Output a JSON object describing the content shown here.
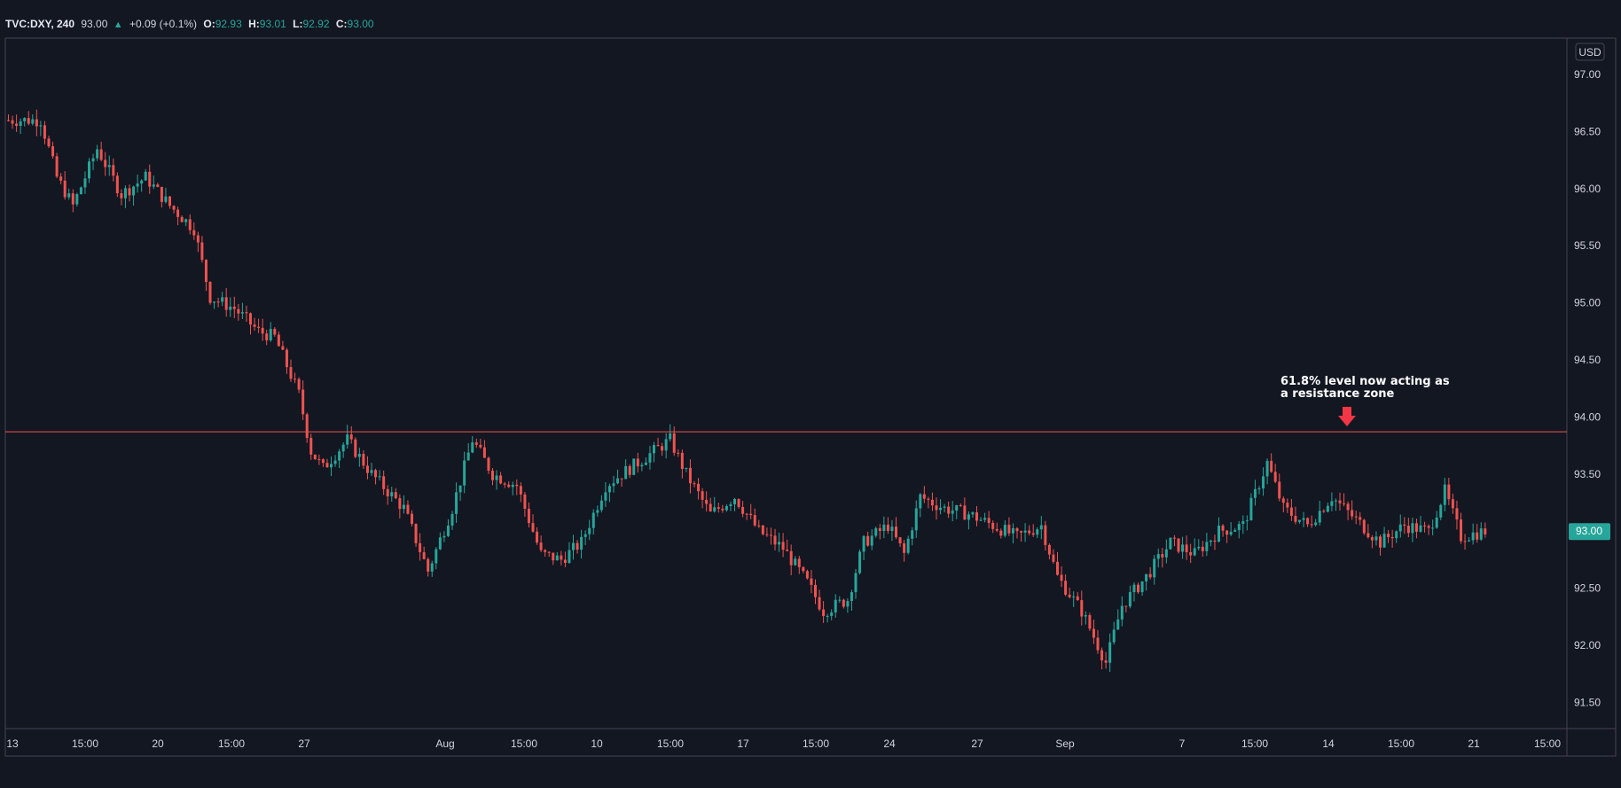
{
  "legend": {
    "symbol": "TVC:DXY, 240",
    "last": "93.00",
    "change": "+0.09 (+0.1%)",
    "o_label": "O:",
    "o": "92.93",
    "h_label": "H:",
    "h": "93.01",
    "l_label": "L:",
    "l": "92.92",
    "c_label": "C:",
    "c": "93.00"
  },
  "colors": {
    "up": "#26a69a",
    "down": "#ef5350",
    "background": "#131722",
    "border": "#787b86",
    "resistance_line": "#ef5350",
    "annotation_arrow": "#f23645"
  },
  "chart_data": {
    "type": "candlestick",
    "currency": "USD",
    "ylim": [
      91.2,
      97.3
    ],
    "y_ticks": [
      97.0,
      96.5,
      96.0,
      95.5,
      95.0,
      94.5,
      94.0,
      93.5,
      93.0,
      92.5,
      92.0,
      91.5
    ],
    "x_ticks": [
      "13",
      "15:00",
      "20",
      "15:00",
      "27",
      "Aug",
      "15:00",
      "10",
      "15:00",
      "17",
      "15:00",
      "24",
      "27",
      "Sep",
      "7",
      "15:00",
      "14",
      "15:00",
      "21",
      "15:00"
    ],
    "last_price": "93.00",
    "resistance_level": 93.87,
    "annotation": {
      "line1": "61.8% level now acting as",
      "line2": "a resistance zone"
    },
    "grid": false,
    "path_points": [
      {
        "bar": 0,
        "price": 96.6
      },
      {
        "bar": 8,
        "price": 96.6
      },
      {
        "bar": 12,
        "price": 96.1
      },
      {
        "bar": 16,
        "price": 95.85
      },
      {
        "bar": 22,
        "price": 96.35
      },
      {
        "bar": 28,
        "price": 95.95
      },
      {
        "bar": 34,
        "price": 96.1
      },
      {
        "bar": 40,
        "price": 95.85
      },
      {
        "bar": 46,
        "price": 95.65
      },
      {
        "bar": 50,
        "price": 95.05
      },
      {
        "bar": 56,
        "price": 94.95
      },
      {
        "bar": 62,
        "price": 94.75
      },
      {
        "bar": 66,
        "price": 94.7
      },
      {
        "bar": 72,
        "price": 94.2
      },
      {
        "bar": 75,
        "price": 93.7
      },
      {
        "bar": 78,
        "price": 93.55
      },
      {
        "bar": 84,
        "price": 93.8
      },
      {
        "bar": 90,
        "price": 93.5
      },
      {
        "bar": 98,
        "price": 93.2
      },
      {
        "bar": 104,
        "price": 92.65
      },
      {
        "bar": 110,
        "price": 93.2
      },
      {
        "bar": 115,
        "price": 93.8
      },
      {
        "bar": 120,
        "price": 93.5
      },
      {
        "bar": 126,
        "price": 93.4
      },
      {
        "bar": 132,
        "price": 92.8
      },
      {
        "bar": 137,
        "price": 92.75
      },
      {
        "bar": 142,
        "price": 92.9
      },
      {
        "bar": 148,
        "price": 93.4
      },
      {
        "bar": 152,
        "price": 93.5
      },
      {
        "bar": 158,
        "price": 93.65
      },
      {
        "bar": 164,
        "price": 93.8
      },
      {
        "bar": 168,
        "price": 93.5
      },
      {
        "bar": 174,
        "price": 93.15
      },
      {
        "bar": 180,
        "price": 93.3
      },
      {
        "bar": 186,
        "price": 93.0
      },
      {
        "bar": 192,
        "price": 92.85
      },
      {
        "bar": 198,
        "price": 92.55
      },
      {
        "bar": 202,
        "price": 92.3
      },
      {
        "bar": 208,
        "price": 92.4
      },
      {
        "bar": 212,
        "price": 92.9
      },
      {
        "bar": 218,
        "price": 93.05
      },
      {
        "bar": 222,
        "price": 92.8
      },
      {
        "bar": 226,
        "price": 93.3
      },
      {
        "bar": 232,
        "price": 93.2
      },
      {
        "bar": 238,
        "price": 93.15
      },
      {
        "bar": 244,
        "price": 93.05
      },
      {
        "bar": 250,
        "price": 92.95
      },
      {
        "bar": 256,
        "price": 93.05
      },
      {
        "bar": 260,
        "price": 92.6
      },
      {
        "bar": 266,
        "price": 92.3
      },
      {
        "bar": 272,
        "price": 91.85
      },
      {
        "bar": 276,
        "price": 92.35
      },
      {
        "bar": 282,
        "price": 92.6
      },
      {
        "bar": 288,
        "price": 92.9
      },
      {
        "bar": 294,
        "price": 92.8
      },
      {
        "bar": 300,
        "price": 93.0
      },
      {
        "bar": 306,
        "price": 93.05
      },
      {
        "bar": 312,
        "price": 93.6
      },
      {
        "bar": 316,
        "price": 93.2
      },
      {
        "bar": 322,
        "price": 93.05
      },
      {
        "bar": 328,
        "price": 93.3
      },
      {
        "bar": 334,
        "price": 93.1
      },
      {
        "bar": 340,
        "price": 92.9
      },
      {
        "bar": 346,
        "price": 93.05
      },
      {
        "bar": 352,
        "price": 93.0
      },
      {
        "bar": 356,
        "price": 93.35
      },
      {
        "bar": 360,
        "price": 92.95
      },
      {
        "bar": 366,
        "price": 93.0
      }
    ]
  }
}
